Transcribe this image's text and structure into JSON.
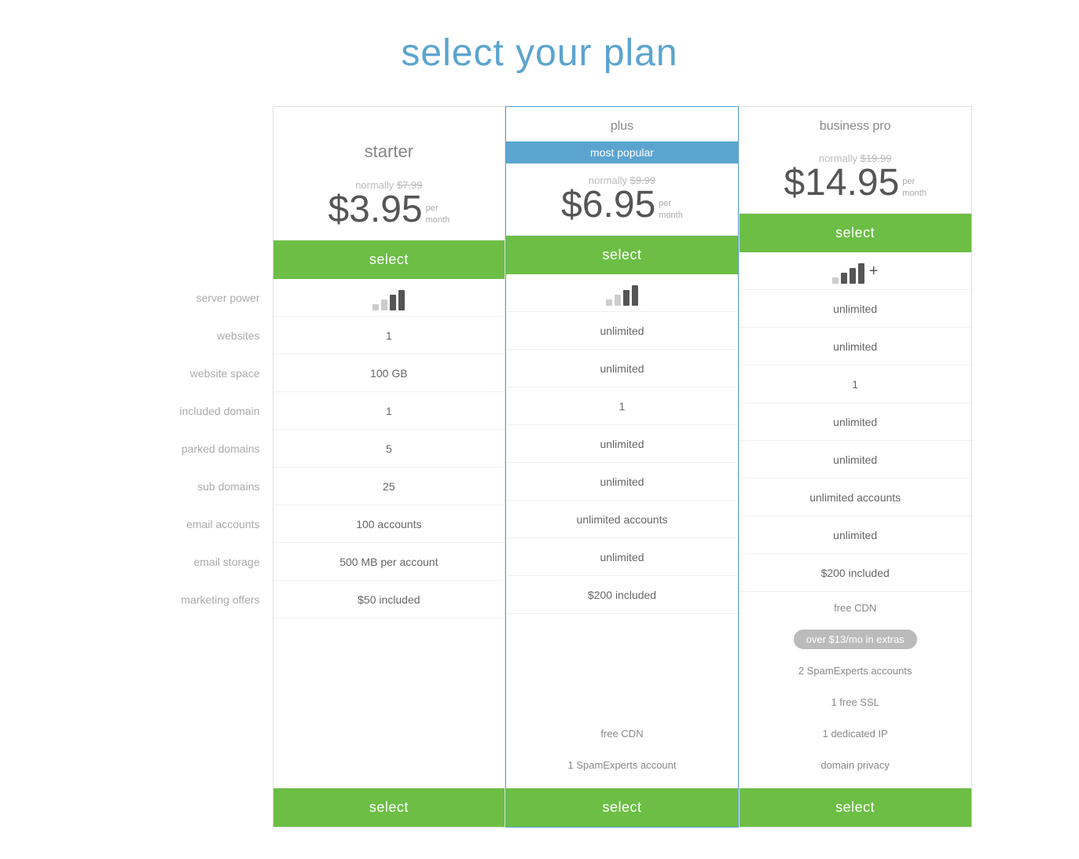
{
  "page": {
    "title": "select your plan"
  },
  "labels": {
    "server_power": "server power",
    "websites": "websites",
    "website_space": "website space",
    "included_domain": "included domain",
    "parked_domains": "parked domains",
    "sub_domains": "sub domains",
    "email_accounts": "email accounts",
    "email_storage": "email storage",
    "marketing_offers": "marketing offers"
  },
  "plans": [
    {
      "id": "starter",
      "label_above": "",
      "name": "starter",
      "popular": false,
      "normally": "$7.99",
      "price": "$3.95",
      "per": "per\nmonth",
      "select_label": "select",
      "signal": [
        false,
        false,
        true,
        true
      ],
      "has_plus": false,
      "websites": "1",
      "website_space": "100 GB",
      "included_domain": "1",
      "parked_domains": "5",
      "sub_domains": "25",
      "email_accounts": "100 accounts",
      "email_storage": "500 MB per account",
      "marketing_offers": "$50 included",
      "extras": []
    },
    {
      "id": "plus",
      "label_above": "plus",
      "name": "most popular",
      "popular": true,
      "normally": "$9.99",
      "price": "$6.95",
      "per": "per\nmonth",
      "select_label": "select",
      "signal": [
        false,
        false,
        true,
        true
      ],
      "has_plus": false,
      "websites": "unlimited",
      "website_space": "unlimited",
      "included_domain": "1",
      "parked_domains": "unlimited",
      "sub_domains": "unlimited",
      "email_accounts": "unlimited accounts",
      "email_storage": "unlimited",
      "marketing_offers": "$200 included",
      "extras": [
        "free CDN",
        "1 SpamExperts account"
      ]
    },
    {
      "id": "business-pro",
      "label_above": "business pro",
      "name": "",
      "popular": false,
      "normally": "$19.99",
      "price": "$14.95",
      "per": "per\nmonth",
      "select_label": "select",
      "signal": [
        false,
        true,
        true,
        true
      ],
      "has_plus": true,
      "websites": "unlimited",
      "website_space": "unlimited",
      "included_domain": "1",
      "parked_domains": "unlimited",
      "sub_domains": "unlimited",
      "email_accounts": "unlimited accounts",
      "email_storage": "unlimited",
      "marketing_offers": "$200 included",
      "extras": [
        "free CDN",
        "over $13/mo in extras",
        "2 SpamExperts accounts",
        "1 free SSL",
        "1 dedicated IP",
        "domain privacy"
      ]
    }
  ]
}
